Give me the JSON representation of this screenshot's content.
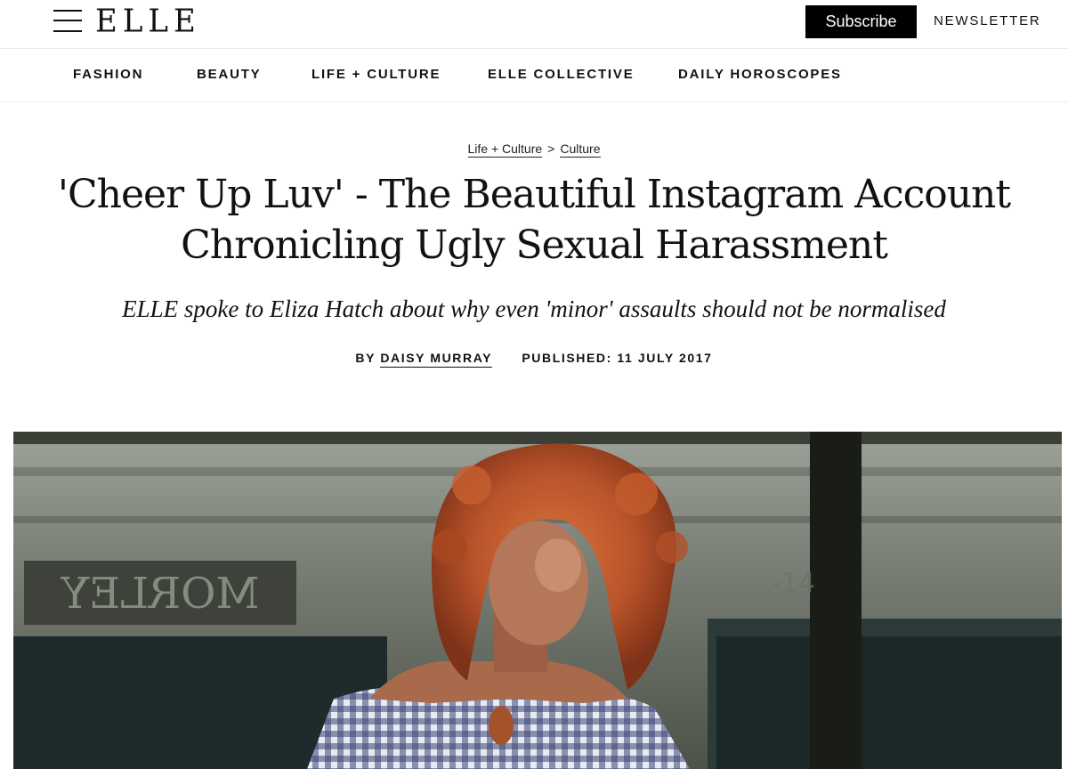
{
  "header": {
    "logo": "ELLE",
    "subscribe_label": "Subscribe",
    "newsletter_label": "NEWSLETTER"
  },
  "nav": {
    "items": [
      {
        "label": "FASHION"
      },
      {
        "label": "BEAUTY"
      },
      {
        "label": "LIFE + CULTURE"
      },
      {
        "label": "ELLE COLLECTIVE"
      },
      {
        "label": "DAILY HOROSCOPES"
      }
    ]
  },
  "breadcrumb": {
    "items": [
      {
        "label": "Life + Culture"
      },
      {
        "label": "Culture"
      }
    ],
    "separator": ">"
  },
  "article": {
    "headline_line1": "'Cheer Up Luv' - The Beautiful Instagram Account",
    "headline_line2": "Chronicling Ugly Sexual Harassment",
    "dek": "ELLE spoke to Eliza Hatch about why even 'minor' assaults should not be normalised",
    "byline_prefix": "BY",
    "author": "DAISY MURRAY",
    "published": "PUBLISHED: 11 JULY 2017"
  },
  "hero": {
    "sign_text": "MORLEY",
    "description_colors": {
      "hair": "#c0582a",
      "wall": "#8a8f86",
      "sign": "#3e423a",
      "dress": "#2f3a66"
    }
  }
}
